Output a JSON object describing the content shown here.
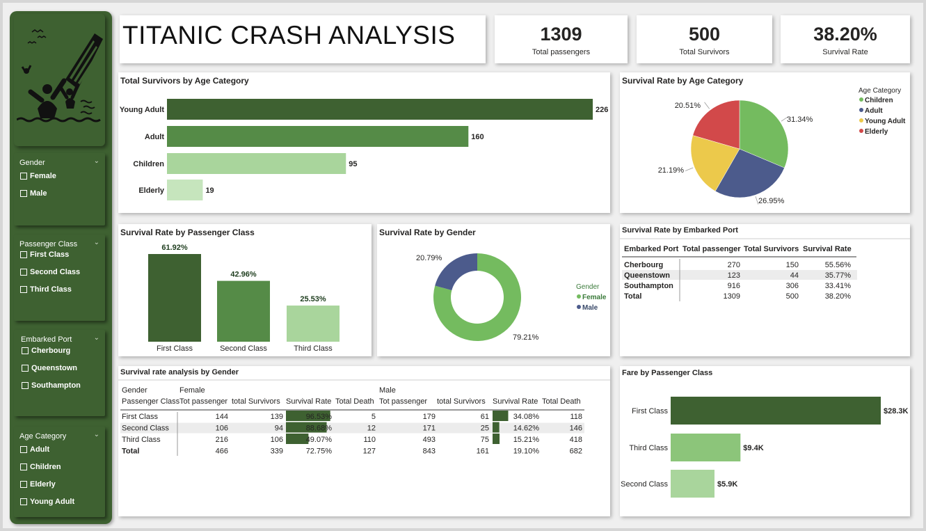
{
  "title": "TITANIC CRASH ANALYSIS",
  "kpis": [
    {
      "value": "1309",
      "label": "Total passengers"
    },
    {
      "value": "500",
      "label": "Total Survivors"
    },
    {
      "value": "38.20%",
      "label": "Survival Rate"
    }
  ],
  "slicers": [
    {
      "title": "Gender",
      "items": [
        "Female",
        "Male"
      ]
    },
    {
      "title": "Passenger Class",
      "items": [
        "First Class",
        "Second Class",
        "Third Class"
      ]
    },
    {
      "title": "Embarked Port",
      "items": [
        "Cherbourg",
        "Queenstown",
        "Southampton"
      ]
    },
    {
      "title": "Age Category",
      "items": [
        "Adult",
        "Children",
        "Elderly",
        "Young Adult"
      ]
    }
  ],
  "colors": {
    "dark_green": "#3e6131",
    "mid_green": "#558b47",
    "light_green": "#a9d59c",
    "pale_green": "#c6e5bd",
    "pie_green": "#74bb5f",
    "pie_blue": "#4c5b8c",
    "pie_yellow": "#ecc94b",
    "pie_red": "#d2494a"
  },
  "charts": {
    "survivors_by_age": {
      "title": "Total Survivors by Age Category",
      "chart_data": {
        "type": "bar",
        "orientation": "horizontal",
        "categories": [
          "Young Adult",
          "Adult",
          "Children",
          "Elderly"
        ],
        "values": [
          226,
          160,
          95,
          19
        ]
      }
    },
    "survival_rate_by_age": {
      "title": "Survival Rate by Age Category",
      "legend_title": "Age Category",
      "chart_data": {
        "type": "pie",
        "categories": [
          "Children",
          "Adult",
          "Young Adult",
          "Elderly"
        ],
        "values": [
          31.34,
          26.95,
          21.19,
          20.51
        ],
        "labels": [
          "31.34%",
          "26.95%",
          "21.19%",
          "20.51%"
        ]
      }
    },
    "survival_rate_by_class": {
      "title": "Survival Rate by Passenger Class",
      "chart_data": {
        "type": "bar",
        "categories": [
          "First Class",
          "Second Class",
          "Third Class"
        ],
        "values": [
          61.92,
          42.96,
          25.53
        ],
        "labels": [
          "61.92%",
          "42.96%",
          "25.53%"
        ]
      }
    },
    "survival_rate_by_gender": {
      "title": "Survival Rate by Gender",
      "legend_title": "Gender",
      "chart_data": {
        "type": "pie",
        "donut": true,
        "categories": [
          "Female",
          "Male"
        ],
        "values": [
          79.21,
          20.79
        ],
        "labels": [
          "79.21%",
          "20.79%"
        ]
      }
    },
    "fare_by_class": {
      "title": "Fare by Passenger Class",
      "chart_data": {
        "type": "bar",
        "orientation": "horizontal",
        "categories": [
          "First Class",
          "Third Class",
          "Second Class"
        ],
        "values": [
          28.3,
          9.4,
          5.9
        ],
        "labels": [
          "$28.3K",
          "$9.4K",
          "$5.9K"
        ],
        "unit": "$K"
      }
    }
  },
  "port_table": {
    "title": "Survival Rate by Embarked Port",
    "headers": [
      "Embarked Port",
      "Total passenger",
      "Total Survivors",
      "Survival Rate"
    ],
    "rows": [
      [
        "Cherbourg",
        "270",
        "150",
        "55.56%"
      ],
      [
        "Queenstown",
        "123",
        "44",
        "35.77%"
      ],
      [
        "Southampton",
        "916",
        "306",
        "33.41%"
      ]
    ],
    "total": [
      "Total",
      "1309",
      "500",
      "38.20%"
    ]
  },
  "gender_table": {
    "title": "Survival rate analysis by Gender",
    "row_header_top": "Gender",
    "row_header": "Passenger Class",
    "groups": [
      "Female",
      "Male"
    ],
    "sub_headers": [
      "Tot passenger",
      "total Survivors",
      "Survival Rate",
      "Total Death"
    ],
    "rows": [
      {
        "label": "First Class",
        "female": [
          "144",
          "139",
          "96.53%",
          "5"
        ],
        "male": [
          "179",
          "61",
          "34.08%",
          "118"
        ],
        "f_rate": 96.53,
        "m_rate": 34.08
      },
      {
        "label": "Second Class",
        "female": [
          "106",
          "94",
          "88.68%",
          "12"
        ],
        "male": [
          "171",
          "25",
          "14.62%",
          "146"
        ],
        "f_rate": 88.68,
        "m_rate": 14.62
      },
      {
        "label": "Third Class",
        "female": [
          "216",
          "106",
          "49.07%",
          "110"
        ],
        "male": [
          "493",
          "75",
          "15.21%",
          "418"
        ],
        "f_rate": 49.07,
        "m_rate": 15.21
      }
    ],
    "total": {
      "label": "Total",
      "female": [
        "466",
        "339",
        "72.75%",
        "127"
      ],
      "male": [
        "843",
        "161",
        "19.10%",
        "682"
      ]
    }
  }
}
